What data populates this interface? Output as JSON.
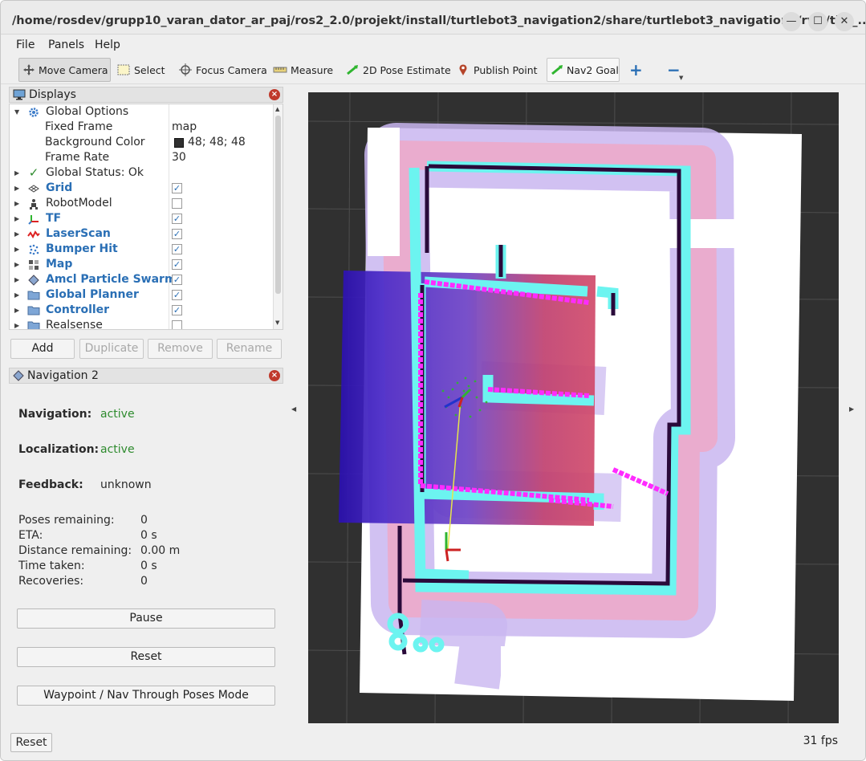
{
  "window": {
    "title": "/home/rosdev/grupp10_varan_dator_ar_paj/ros2_2.0/projekt/install/turtlebot3_navigation2/share/turtlebot3_navigation2/rviz/tb3_...",
    "controls": {
      "minimize": "—",
      "maximize": "☐",
      "close": "✕"
    }
  },
  "menu": {
    "file": "File",
    "panels": "Panels",
    "help": "Help"
  },
  "toolbar": {
    "move_camera": "Move Camera",
    "select": "Select",
    "focus_camera": "Focus Camera",
    "measure": "Measure",
    "pose_estimate": "2D Pose Estimate",
    "publish_point": "Publish Point",
    "nav2_goal": "Nav2 Goal",
    "plus": "+",
    "minus": "−"
  },
  "displays": {
    "header": "Displays",
    "global_options": "Global Options",
    "fixed_frame_label": "Fixed Frame",
    "fixed_frame_value": "map",
    "background_color_label": "Background Color",
    "background_color_value": "48; 48; 48",
    "frame_rate_label": "Frame Rate",
    "frame_rate_value": "30",
    "global_status": "Global Status: Ok",
    "items": [
      {
        "name": "Grid",
        "checked": true
      },
      {
        "name": "RobotModel",
        "checked": false
      },
      {
        "name": "TF",
        "checked": true
      },
      {
        "name": "LaserScan",
        "checked": true
      },
      {
        "name": "Bumper Hit",
        "checked": true
      },
      {
        "name": "Map",
        "checked": true
      },
      {
        "name": "Amcl Particle Swarm",
        "checked": true
      },
      {
        "name": "Global Planner",
        "checked": true
      },
      {
        "name": "Controller",
        "checked": true
      },
      {
        "name": "Realsense",
        "checked": false
      }
    ],
    "buttons": {
      "add": "Add",
      "duplicate": "Duplicate",
      "remove": "Remove",
      "rename": "Rename"
    }
  },
  "navigation": {
    "header": "Navigation 2",
    "navigation_label": "Navigation:",
    "navigation_value": "active",
    "localization_label": "Localization:",
    "localization_value": "active",
    "feedback_label": "Feedback:",
    "feedback_value": "unknown",
    "poses_remaining_label": "Poses remaining:",
    "poses_remaining_value": "0",
    "eta_label": "ETA:",
    "eta_value": "0 s",
    "distance_label": "Distance remaining:",
    "distance_value": "0.00 m",
    "time_label": "Time taken:",
    "time_value": "0 s",
    "recoveries_label": "Recoveries:",
    "recoveries_value": "0",
    "pause_button": "Pause",
    "reset_button": "Reset",
    "waypoint_button": "Waypoint / Nav Through Poses Mode"
  },
  "footer": {
    "reset": "Reset",
    "fps": "31 fps"
  },
  "colors": {
    "background": "#303030",
    "costmap_cyan": "#66f2f2",
    "costmap_magenta": "#ff00ff",
    "wall": "#2a0a3a",
    "status_green": "#2e8b2e",
    "link_blue": "#2a6fb5"
  }
}
